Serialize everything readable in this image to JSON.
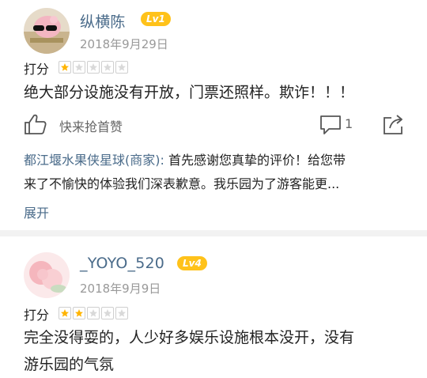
{
  "reviews": [
    {
      "username": "纵横陈",
      "level": "Lv1",
      "date": "2018年9月29日",
      "rating_label": "打分",
      "rating": 1,
      "rating_max": 5,
      "text": "绝大部分设施没有开放，门票还照样。欺诈！！！",
      "like_label": "快来抢首赞",
      "comment_count": "1",
      "reply": {
        "merchant": "都江堰水果侠星球(商家):",
        "line1_rest": " 首先感谢您真挚的评价！给您带",
        "line2": "来了不愉快的体验我们深表歉意。我乐园为了游客能更..."
      },
      "expand_label": "展开"
    },
    {
      "username": "_YOYO_520",
      "level": "Lv4",
      "date": "2018年9月9日",
      "rating_label": "打分",
      "rating": 2,
      "rating_max": 5,
      "text_line1": "完全没得耍的，人少好多娱乐设施根本没开，没有",
      "text_line2": "游乐园的气氛"
    }
  ],
  "colors": {
    "accent": "#4a6b8a",
    "level_badge": "#ffc21a",
    "star_filled": "#ffb400",
    "star_empty": "#d9d9d9"
  },
  "icons": {
    "like": "thumb-up-icon",
    "comment": "comment-icon",
    "share": "share-icon"
  }
}
